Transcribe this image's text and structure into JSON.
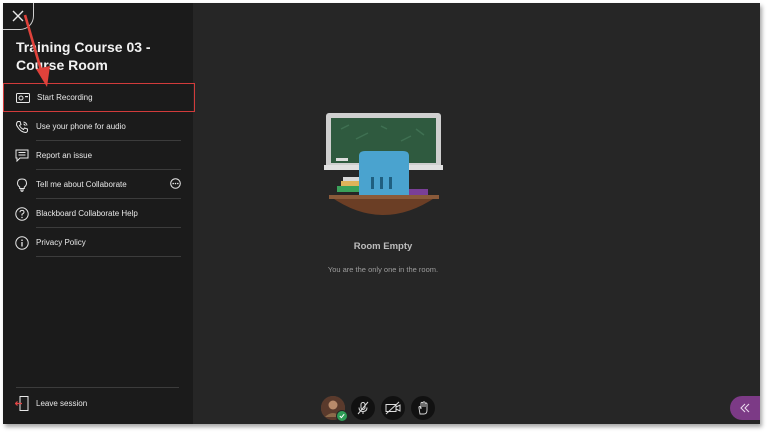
{
  "panel": {
    "title": "Training Course 03 - Course Room",
    "menu": [
      {
        "label": "Start Recording",
        "icon": "record-icon"
      },
      {
        "label": "Use your phone for audio",
        "icon": "phone-icon"
      },
      {
        "label": "Report an issue",
        "icon": "report-icon"
      },
      {
        "label": "Tell me about Collaborate",
        "icon": "lightbulb-icon"
      },
      {
        "label": "Blackboard Collaborate Help",
        "icon": "help-icon"
      },
      {
        "label": "Privacy Policy",
        "icon": "info-icon"
      }
    ],
    "leave_label": "Leave session"
  },
  "room": {
    "title": "Room Empty",
    "subtitle": "You are the only one in the room."
  },
  "colors": {
    "panel_bg": "#1b1b1b",
    "stage_bg": "#262626",
    "highlight": "#d23b3b",
    "collab_button": "#7c3a86"
  }
}
